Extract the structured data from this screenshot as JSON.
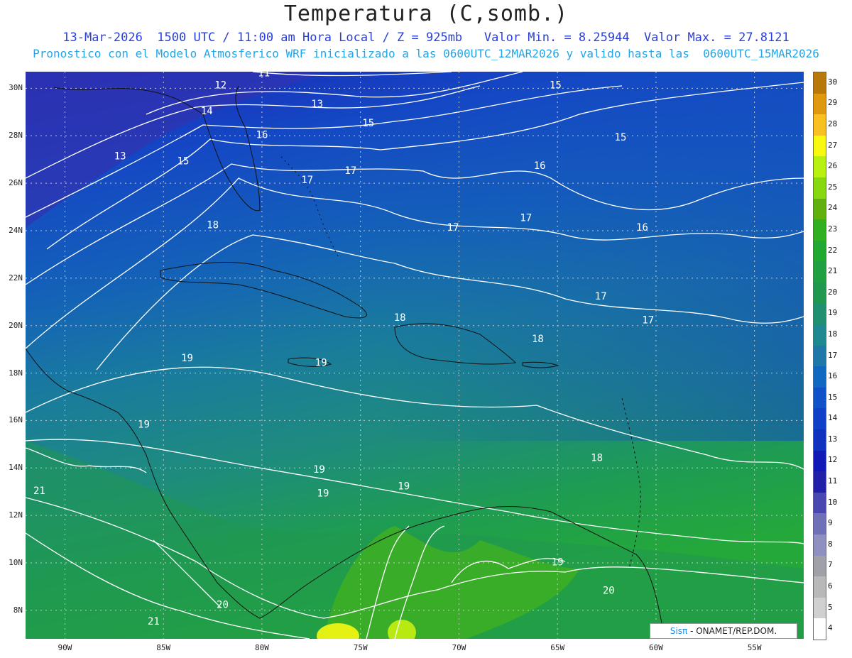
{
  "header": {
    "title": "Temperatura (C,somb.)",
    "line1": "13-Mar-2026  1500 UTC / 11:00 am Hora Local / Z = 925mb   Valor Min. = 8.25944  Valor Max. = 27.8121",
    "line2": "Pronostico con el Modelo Atmosferico WRF inicializado a las 0600UTC_12MAR2026 y valido hasta las  0600UTC_15MAR2026"
  },
  "axes": {
    "lat_labels": [
      "30N",
      "28N",
      "26N",
      "24N",
      "22N",
      "20N",
      "18N",
      "16N",
      "14N",
      "12N",
      "10N",
      "8N"
    ],
    "lon_labels": [
      "90W",
      "85W",
      "80W",
      "75W",
      "70W",
      "65W",
      "60W",
      "55W"
    ]
  },
  "colorbar": {
    "labels": [
      "30",
      "29",
      "28",
      "27",
      "26",
      "25",
      "24",
      "23",
      "22",
      "21",
      "20",
      "19",
      "18",
      "17",
      "16",
      "15",
      "14",
      "13",
      "12",
      "11",
      "10",
      "9",
      "8",
      "7",
      "6",
      "5",
      "4"
    ],
    "colors": [
      "#b8780a",
      "#e09810",
      "#f8c020",
      "#f8f810",
      "#b8f010",
      "#88d810",
      "#60b010",
      "#30b020",
      "#20a830",
      "#20a040",
      "#209850",
      "#209070",
      "#208890",
      "#2078a8",
      "#1068c0",
      "#1050c8",
      "#1040c8",
      "#1030c0",
      "#1018b8",
      "#2020a8",
      "#4848b0",
      "#7070b8",
      "#9090c0",
      "#a0a0a8",
      "#b8b8b8",
      "#d0d0d0",
      "#ffffff"
    ]
  },
  "contour_labels": [
    {
      "text": "11",
      "lon": -79.9,
      "lat": 30.5
    },
    {
      "text": "12",
      "lon": -82.1,
      "lat": 30.0
    },
    {
      "text": "13",
      "lon": -77.2,
      "lat": 29.2
    },
    {
      "text": "14",
      "lon": -82.8,
      "lat": 28.9
    },
    {
      "text": "15",
      "lon": -74.6,
      "lat": 28.4
    },
    {
      "text": "15",
      "lon": -65.1,
      "lat": 30.0
    },
    {
      "text": "15",
      "lon": -61.8,
      "lat": 27.8
    },
    {
      "text": "16",
      "lon": -80.0,
      "lat": 27.9
    },
    {
      "text": "16",
      "lon": -65.9,
      "lat": 26.6
    },
    {
      "text": "16",
      "lon": -60.7,
      "lat": 24.0
    },
    {
      "text": "13",
      "lon": -87.2,
      "lat": 27.0
    },
    {
      "text": "15",
      "lon": -84.0,
      "lat": 26.8
    },
    {
      "text": "17",
      "lon": -77.7,
      "lat": 26.0
    },
    {
      "text": "17",
      "lon": -75.5,
      "lat": 26.4
    },
    {
      "text": "17",
      "lon": -70.3,
      "lat": 24.0
    },
    {
      "text": "17",
      "lon": -66.6,
      "lat": 24.4
    },
    {
      "text": "17",
      "lon": -62.8,
      "lat": 21.1
    },
    {
      "text": "17",
      "lon": -60.4,
      "lat": 20.1
    },
    {
      "text": "18",
      "lon": -82.5,
      "lat": 24.1
    },
    {
      "text": "18",
      "lon": -73.0,
      "lat": 20.2
    },
    {
      "text": "18",
      "lon": -66.0,
      "lat": 19.3
    },
    {
      "text": "18",
      "lon": -63.0,
      "lat": 14.3
    },
    {
      "text": "19",
      "lon": -83.8,
      "lat": 18.5
    },
    {
      "text": "19",
      "lon": -77.0,
      "lat": 18.3
    },
    {
      "text": "19",
      "lon": -86.0,
      "lat": 15.7
    },
    {
      "text": "19",
      "lon": -77.1,
      "lat": 13.8
    },
    {
      "text": "19",
      "lon": -76.9,
      "lat": 12.8
    },
    {
      "text": "19",
      "lon": -72.8,
      "lat": 13.1
    },
    {
      "text": "19",
      "lon": -65.0,
      "lat": 9.9
    },
    {
      "text": "20",
      "lon": -62.4,
      "lat": 8.7
    },
    {
      "text": "20",
      "lon": -82.0,
      "lat": 8.1
    },
    {
      "text": "21",
      "lon": -91.3,
      "lat": 12.9
    },
    {
      "text": "21",
      "lon": -85.5,
      "lat": 7.4
    }
  ],
  "credit": {
    "sis": "Sisπ",
    "rest": " - ONAMET/REP.DOM."
  }
}
